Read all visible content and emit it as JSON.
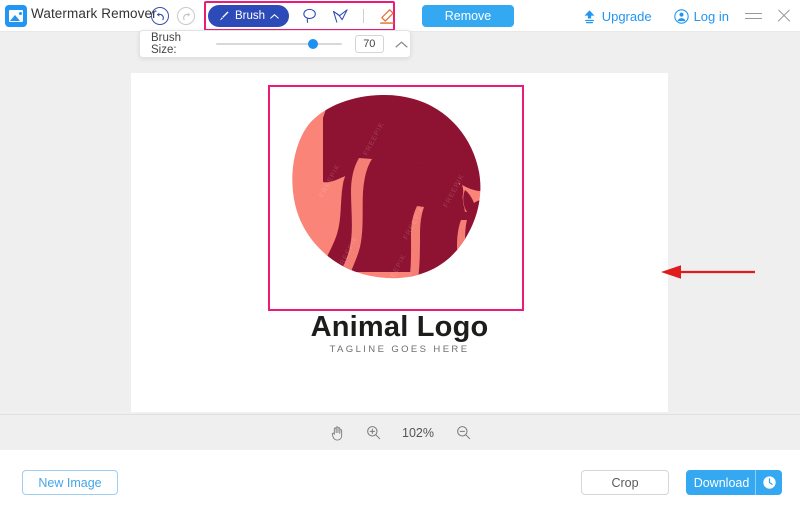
{
  "app": {
    "title": "Watermark Remover",
    "logo_icon": "image-app-icon"
  },
  "header": {
    "undo_icon": "undo-arrow-icon",
    "redo_icon": "redo-arrow-icon",
    "tools": [
      {
        "id": "brush",
        "label": "Brush",
        "icon": "brush-icon",
        "chevron": "chevron-up-icon",
        "active": true
      },
      {
        "id": "lasso",
        "label": "Lasso",
        "icon": "lasso-icon",
        "active": false
      },
      {
        "id": "polygon",
        "label": "Polygon",
        "icon": "polygon-lasso-icon",
        "active": false
      },
      {
        "id": "eraser",
        "label": "Eraser",
        "icon": "eraser-icon",
        "active": false
      }
    ],
    "remove_label": "Remove",
    "upgrade_label": "Upgrade",
    "upgrade_icon": "upload-upgrade-icon",
    "login_label": "Log in",
    "login_icon": "user-avatar-icon",
    "menu_icon": "hamburger-menu-icon",
    "close_icon": "close-icon",
    "highlight_color": "#ec1b79",
    "accent_color": "#2196f3"
  },
  "brush_panel": {
    "label": "Brush Size:",
    "value": "70",
    "slider_percent": 66,
    "collapse_icon": "chevron-up-icon"
  },
  "canvas": {
    "selection_color": "#ec1b79",
    "annotation_arrow_color": "#e01b1b",
    "image": {
      "name": "animal-logo",
      "title": "Animal Logo",
      "tagline": "TAGLINE GOES HERE",
      "watermark_text": "FREEPIK",
      "body_color": "#fb8479",
      "silhouette_color": "#8e1332",
      "title_color": "#1d1d1b",
      "tagline_color": "#6f6f6f"
    }
  },
  "zoombar": {
    "pan_icon": "hand-pan-icon",
    "zoom_in_icon": "zoom-in-icon",
    "zoom_out_icon": "zoom-out-icon",
    "level": "102%"
  },
  "footer": {
    "new_image_label": "New Image",
    "crop_label": "Crop",
    "download_label": "Download",
    "download_icon": "history-clock-icon"
  }
}
